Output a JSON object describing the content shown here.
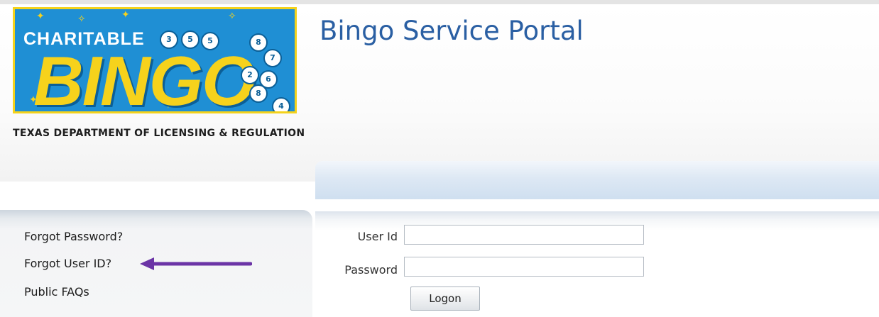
{
  "logo": {
    "charitable": "CHARITABLE",
    "bingo": "BINGO",
    "department": "TEXAS DEPARTMENT OF LICENSING & REGULATION",
    "balls": [
      "3",
      "5",
      "5",
      "8",
      "7",
      "2",
      "6",
      "8",
      "4"
    ]
  },
  "header": {
    "title": "Bingo Service Portal"
  },
  "sidebar": {
    "links": [
      "Forgot Password?",
      "Forgot User ID?",
      "Public FAQs"
    ],
    "arrow_color": "#6b34a6"
  },
  "login": {
    "user_id_label": "User Id",
    "user_id_value": "",
    "password_label": "Password",
    "password_value": "",
    "submit_label": "Logon"
  },
  "colors": {
    "title": "#2a5fa3",
    "logo_blue": "#1f8fd4",
    "logo_yellow": "#f6d21c"
  }
}
